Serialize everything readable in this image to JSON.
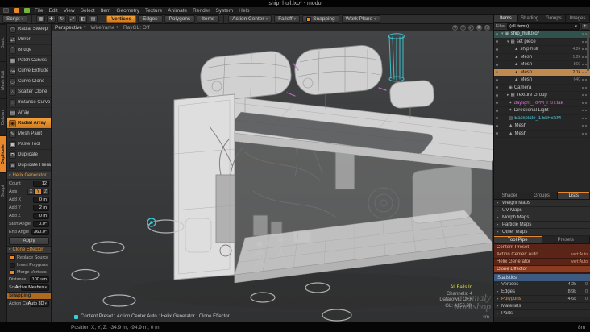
{
  "window": {
    "title": "ship_hull.lxo* - modo"
  },
  "glyphs": {
    "chevron_down": "▾",
    "chevron_right": "▸"
  },
  "colors": {
    "accent": "#e8872c",
    "selection": "#c18a4f",
    "cyan": "#3fc6d4",
    "magenta": "#d06ad0"
  },
  "menu": {
    "items": [
      "File",
      "Edit",
      "View",
      "Select",
      "Item",
      "Geometry",
      "Texture",
      "Animate",
      "Render",
      "System",
      "Help"
    ]
  },
  "toolbar": {
    "script_label": "Script",
    "icons": [
      {
        "name": "layout-grid-icon",
        "glyph": "▦"
      },
      {
        "name": "add-item-icon",
        "glyph": "✚"
      },
      {
        "name": "rotate-tool-icon",
        "glyph": "↻"
      },
      {
        "name": "scale-tool-icon",
        "glyph": "⤢"
      },
      {
        "name": "mirror-icon",
        "glyph": "◧"
      },
      {
        "name": "list-view-icon",
        "glyph": "▤"
      }
    ],
    "modes": [
      {
        "label": "Vertices",
        "cls": "active"
      },
      {
        "label": "Edges",
        "cls": ""
      },
      {
        "label": "Polygons",
        "cls": ""
      },
      {
        "label": "Items",
        "cls": ""
      }
    ],
    "action_center_label": "Action Center",
    "falloff_label": "Falloff",
    "snapping_label": "Snapping",
    "work_plane_label": "Work Plane"
  },
  "left_tabs": [
    {
      "label": "Basic",
      "cls": ""
    },
    {
      "label": "Mesh Edit",
      "cls": ""
    },
    {
      "label": "Deform",
      "cls": ""
    },
    {
      "label": "Duplicate",
      "cls": "active"
    },
    {
      "label": "Sculpt",
      "cls": ""
    }
  ],
  "tools": [
    {
      "label": "Radial Sweep",
      "glyph": "◠",
      "cls": ""
    },
    {
      "label": "Mirror",
      "glyph": "⇄",
      "cls": ""
    },
    {
      "label": "Bridge",
      "glyph": "⌒",
      "cls": ""
    },
    {
      "label": "Patch Curves",
      "glyph": "▦",
      "cls": ""
    },
    {
      "label": "Curve Extrude",
      "glyph": "↝",
      "cls": ""
    },
    {
      "label": "Curve Clone",
      "glyph": "◡",
      "cls": ""
    },
    {
      "label": "Scatter Clone",
      "glyph": "∴",
      "cls": ""
    },
    {
      "label": "Instance Curve",
      "glyph": "◌",
      "cls": ""
    },
    {
      "label": "Array",
      "glyph": "▤",
      "cls": ""
    },
    {
      "label": "Radial Array",
      "glyph": "◉",
      "cls": "active"
    },
    {
      "label": "Mesh Paint",
      "glyph": "✎",
      "cls": ""
    },
    {
      "label": "Paste Tool",
      "glyph": "▣",
      "cls": ""
    },
    {
      "label": "Duplicate",
      "glyph": "⧉",
      "cls": ""
    },
    {
      "label": "Duplicate Hierarchy",
      "glyph": "⧈",
      "cls": ""
    }
  ],
  "props": {
    "header": "Helix Generator",
    "count_label": "Count",
    "count_value": "12",
    "axis_label": "Axis",
    "axis": [
      {
        "label": "X",
        "cls": ""
      },
      {
        "label": "Y",
        "cls": "active"
      },
      {
        "label": "Z",
        "cls": ""
      }
    ],
    "fields": [
      {
        "label": "Add X",
        "value": "0 m"
      },
      {
        "label": "Add Y",
        "value": "2 m"
      },
      {
        "label": "Add Z",
        "value": "0 m"
      },
      {
        "label": "Start Angle",
        "value": "0.0°"
      },
      {
        "label": "End Angle",
        "value": "360.0°"
      }
    ],
    "apply_label": "Apply",
    "effector_header": "Clone Effector",
    "checks": [
      {
        "label": "Replace Source",
        "cls": "checked"
      },
      {
        "label": "Invert Polygons",
        "cls": ""
      },
      {
        "label": "Merge Vertices",
        "cls": "checked"
      }
    ],
    "fields2": [
      {
        "label": "Distance",
        "value": "100 um"
      }
    ],
    "source_label": "Source",
    "source_value": "Active Meshes",
    "snapping_header": "Snapping",
    "action_center_label": "Action Center",
    "action_center_value": "Auto 3D"
  },
  "viewport": {
    "view_label": "Perspective",
    "shade_label": "Wireframe",
    "raygl_label": "RayGL: Off",
    "nav_icons": [
      {
        "name": "orbit-icon",
        "glyph": "⟲"
      },
      {
        "name": "pan-icon",
        "glyph": "✚"
      },
      {
        "name": "zoom-icon",
        "glyph": "⤢"
      },
      {
        "name": "grid-toggle-icon",
        "glyph": "▦"
      },
      {
        "name": "maximize-icon",
        "glyph": "◱"
      }
    ],
    "hud": {
      "line1": "All Falls In",
      "line2": "Channels: 4",
      "line3": "Datarows: OFF",
      "line4": "GL: 4156.9K",
      "grid_label": "4m"
    },
    "tool_readout": "Content Preset : Action Center Auto : Helix Generator : Clone Effector",
    "watermark": {
      "line1": "anomaly",
      "line2": "workshop"
    }
  },
  "right": {
    "tabs": [
      {
        "label": "Items",
        "cls": "active"
      },
      {
        "label": "Shading",
        "cls": ""
      },
      {
        "label": "Groups",
        "cls": ""
      },
      {
        "label": "Images",
        "cls": ""
      }
    ],
    "filter_label": "Filter",
    "filter_value": "(all items)",
    "add_label": "+",
    "tree": [
      {
        "label": "ship_hull.lxo*",
        "level": 0,
        "tw": "▾",
        "icon": "▣",
        "cls": "root",
        "count": ""
      },
      {
        "label": "set piece",
        "level": 1,
        "tw": "▾",
        "icon": "▦",
        "cls": "",
        "count": ""
      },
      {
        "label": "ship hull",
        "level": 2,
        "tw": "",
        "icon": "▲",
        "cls": "",
        "count": "4.2k"
      },
      {
        "label": "Mesh",
        "level": 2,
        "tw": "",
        "icon": "▲",
        "cls": "",
        "count": "1.2k"
      },
      {
        "label": "Mesh",
        "level": 2,
        "tw": "",
        "icon": "▲",
        "cls": "",
        "count": "860"
      },
      {
        "label": "Mesh",
        "level": 2,
        "tw": "",
        "icon": "▲",
        "cls": "sel",
        "count": "2.1k"
      },
      {
        "label": "Mesh",
        "level": 2,
        "tw": "",
        "icon": "▲",
        "cls": "",
        "count": "640"
      },
      {
        "label": "Camera",
        "level": 1,
        "tw": "",
        "icon": "◉",
        "cls": "",
        "count": ""
      },
      {
        "label": "Texture Group",
        "level": 1,
        "tw": "▸",
        "icon": "▦",
        "cls": "",
        "count": ""
      },
      {
        "label": "daylight_RPM_FST.tak",
        "level": 1,
        "tw": "",
        "icon": "✦",
        "cls": "magenta",
        "count": ""
      },
      {
        "label": "Directional Light",
        "level": 1,
        "tw": "",
        "icon": "✦",
        "cls": "",
        "count": ""
      },
      {
        "label": "Backplate_1.5kFSSM",
        "level": 1,
        "tw": "",
        "icon": "▨",
        "cls": "cyan",
        "count": ""
      },
      {
        "label": "Mesh",
        "level": 1,
        "tw": "",
        "icon": "▲",
        "cls": "",
        "count": ""
      },
      {
        "label": "Mesh",
        "level": 1,
        "tw": "",
        "icon": "▲",
        "cls": "",
        "count": ""
      }
    ],
    "lists": {
      "tabs": [
        {
          "label": "Shader",
          "cls": ""
        },
        {
          "label": "Groups",
          "cls": ""
        },
        {
          "label": "Lists",
          "cls": "active"
        }
      ],
      "rows": [
        {
          "label": "Weight Maps",
          "tw": "▸"
        },
        {
          "label": "UV Maps",
          "tw": "▸"
        },
        {
          "label": "Morph Maps",
          "tw": "▸"
        },
        {
          "label": "Particle Maps",
          "tw": "▸"
        },
        {
          "label": "Other Maps",
          "tw": "▸"
        }
      ]
    },
    "pipeline": {
      "tabs": [
        {
          "label": "Tool Pipe",
          "cls": "active"
        },
        {
          "label": "Presets",
          "cls": ""
        }
      ],
      "rows": [
        {
          "label": "Content Preset",
          "value": "",
          "cls": ""
        },
        {
          "label": "Action Center: Auto",
          "value": "vert:Auto",
          "cls": ""
        },
        {
          "label": "Helix Generator",
          "value": "vert:Auto",
          "cls": ""
        },
        {
          "label": "Clone Effector",
          "value": "",
          "cls": "hot"
        }
      ]
    },
    "stats": {
      "header": "Statistics",
      "rows": [
        {
          "label": "Vertices",
          "total": "4.2k",
          "selected": "0",
          "tw": "▸",
          "cls": ""
        },
        {
          "label": "Edges",
          "total": "8.9k",
          "selected": "0",
          "tw": "▸",
          "cls": ""
        },
        {
          "label": "Polygons",
          "total": "4.6k",
          "selected": "0",
          "tw": "▸",
          "cls": "sel"
        },
        {
          "label": "Materials",
          "total": "",
          "selected": "",
          "tw": "▸",
          "cls": ""
        },
        {
          "label": "Parts",
          "total": "",
          "selected": "",
          "tw": "▸",
          "cls": ""
        }
      ]
    }
  },
  "status": {
    "left": "Position X, Y, Z:  -34.9 m, -94.9 m, 0 m",
    "right": "8m"
  }
}
